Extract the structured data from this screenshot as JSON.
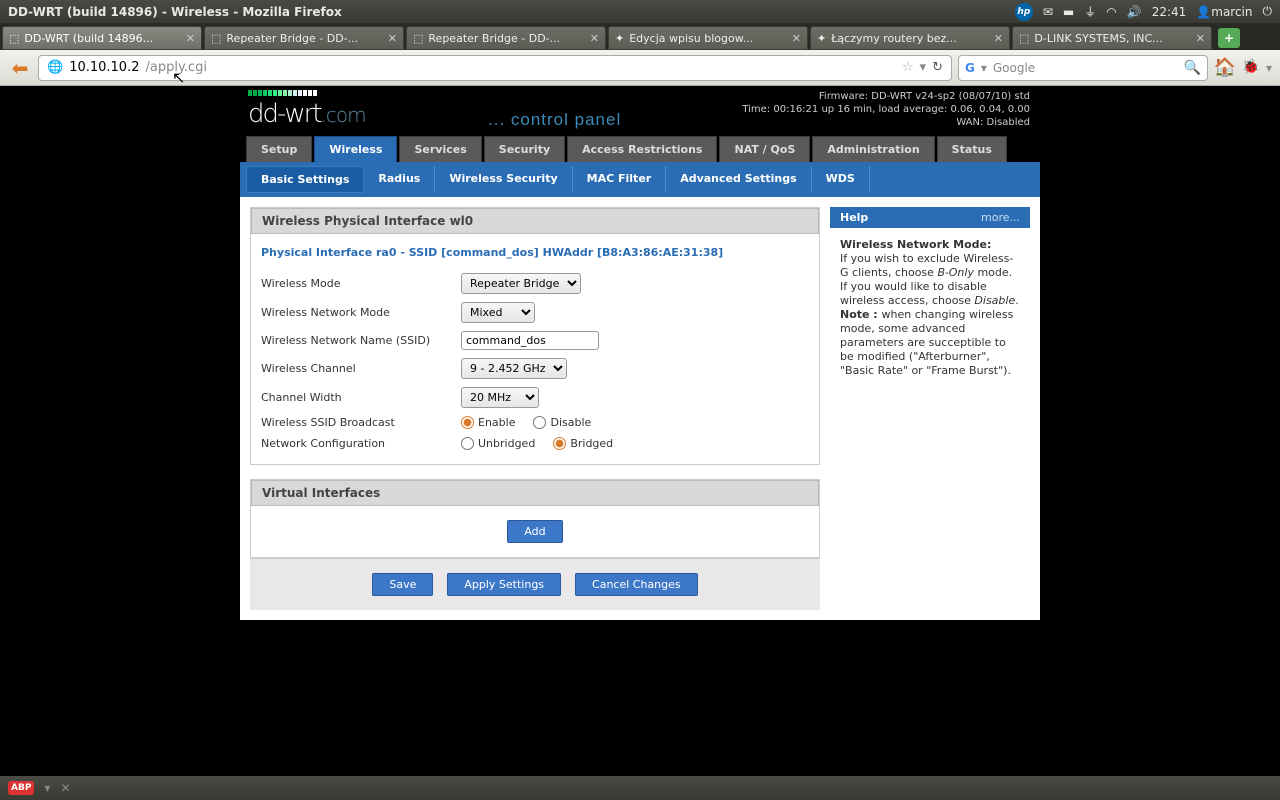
{
  "os": {
    "window_title": "DD-WRT (build 14896) - Wireless - Mozilla Firefox",
    "time": "22:41",
    "user": "marcin"
  },
  "tabs": [
    {
      "label": "DD-WRT (build 14896...",
      "active": true
    },
    {
      "label": "Repeater Bridge - DD-...",
      "active": false
    },
    {
      "label": "Repeater Bridge - DD-...",
      "active": false
    },
    {
      "label": "Edycja wpisu blogow...",
      "active": false
    },
    {
      "label": "Łączymy routery bez...",
      "active": false
    },
    {
      "label": "D-LINK SYSTEMS, INC...",
      "active": false
    }
  ],
  "url": {
    "host": "10.10.10.2",
    "path": "/apply.cgi"
  },
  "search_placeholder": "Google",
  "ddwrt": {
    "logo": "dd-wrt",
    "logo_ext": ".com",
    "cpanel": "... control panel",
    "firmware": "Firmware: DD-WRT v24-sp2 (08/07/10) std",
    "uptime": "Time: 00:16:21 up 16 min, load average: 0.06, 0.04, 0.00",
    "wan": "WAN: Disabled",
    "main_tabs": [
      "Setup",
      "Wireless",
      "Services",
      "Security",
      "Access Restrictions",
      "NAT / QoS",
      "Administration",
      "Status"
    ],
    "main_active": "Wireless",
    "sub_tabs": [
      "Basic Settings",
      "Radius",
      "Wireless Security",
      "MAC Filter",
      "Advanced Settings",
      "WDS"
    ],
    "sub_active": "Basic Settings",
    "section1_title": "Wireless Physical Interface wl0",
    "phys_if": "Physical Interface ra0 - SSID [command_dos] HWAddr [B8:A3:86:AE:31:38]",
    "labels": {
      "mode": "Wireless Mode",
      "netmode": "Wireless Network Mode",
      "ssid": "Wireless Network Name (SSID)",
      "channel": "Wireless Channel",
      "width": "Channel Width",
      "broadcast": "Wireless SSID Broadcast",
      "netconf": "Network Configuration"
    },
    "values": {
      "mode": "Repeater Bridge",
      "netmode": "Mixed",
      "ssid": "command_dos",
      "channel": "9 - 2.452 GHz",
      "width": "20 MHz"
    },
    "radio": {
      "enable": "Enable",
      "disable": "Disable",
      "unbridged": "Unbridged",
      "bridged": "Bridged"
    },
    "section2_title": "Virtual Interfaces",
    "buttons": {
      "add": "Add",
      "save": "Save",
      "apply": "Apply Settings",
      "cancel": "Cancel Changes"
    },
    "help": {
      "title": "Help",
      "more": "more...",
      "heading": "Wireless Network Mode:",
      "p1a": "If you wish to exclude Wireless-G clients, choose ",
      "p1b": "B-Only",
      "p1c": " mode. If you would like to disable wireless access, choose ",
      "p1d": "Disable",
      "p1e": ".",
      "note_label": "Note : ",
      "note": "when changing wireless mode, some advanced parameters are succeptible to be modified (\"Afterburner\", \"Basic Rate\" or \"Frame Burst\")."
    }
  }
}
